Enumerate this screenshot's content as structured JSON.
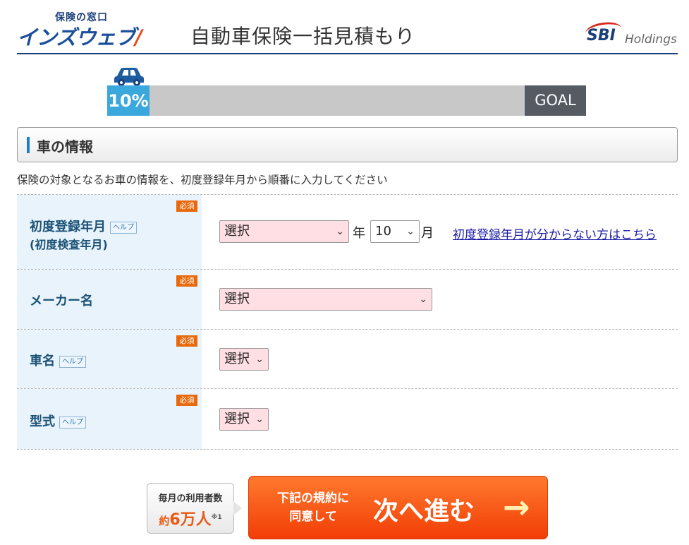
{
  "header": {
    "logo_sub": "保険の窓口",
    "logo_main": "インズウェブ",
    "logo_mark": "/",
    "title": "自動車保険一括見積もり",
    "brand_mark": "SBI",
    "brand_text": "Holdings"
  },
  "progress": {
    "percent_label": "10%",
    "percent_value": 10,
    "goal_label": "GOAL",
    "icon": "car-icon"
  },
  "section": {
    "title": "車の情報",
    "intro": "保険の対象となるお車の情報を、初度登録年月から順番に入力してください"
  },
  "form": {
    "required_badge": "必須",
    "help_badge": "ヘルプ",
    "registration": {
      "label": "初度登録年月",
      "sublabel": "(初度検査年月)",
      "year_value": "選択",
      "year_unit": "年",
      "month_value": "10",
      "month_unit": "月",
      "link": "初度登録年月が分からない方はこちら"
    },
    "maker": {
      "label": "メーカー名",
      "value": "選択"
    },
    "car_name": {
      "label": "車名",
      "value": "選択"
    },
    "model": {
      "label": "型式",
      "value": "選択"
    }
  },
  "cta": {
    "users_top": "毎月の利用者数",
    "users_prefix": "約",
    "users_number": "6万人",
    "users_note": "※1",
    "small_line1": "下記の規約に",
    "small_line2": "同意して",
    "big": "次へ進む",
    "arrow": "→"
  },
  "colors": {
    "accent": "#1b3f7a",
    "progress": "#3aa8dd",
    "required": "#e8680b",
    "cta": "#f23d06",
    "label_bg": "#e8f3fb",
    "select_bg": "#ffdfe3"
  }
}
